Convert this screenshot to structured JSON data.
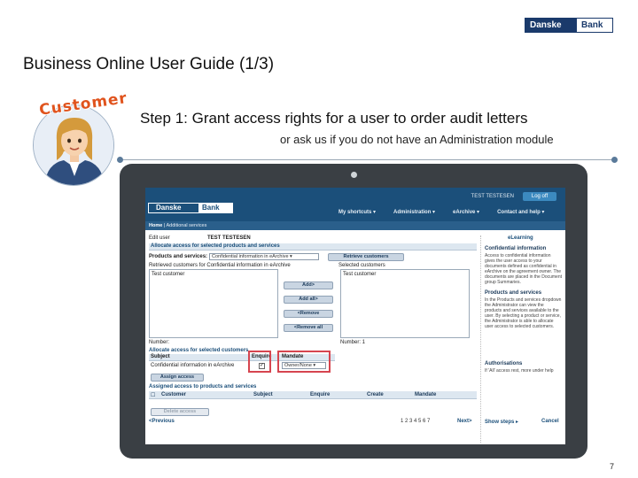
{
  "brand": {
    "left": "Danske",
    "right": "Bank"
  },
  "slide": {
    "title": "Business Online User Guide (1/3)",
    "step_title": "Step 1: Grant access rights for a user to order audit letters",
    "step_sub": "or ask us if you do not have an Administration module",
    "badge": "Customer",
    "page_number": "7"
  },
  "app": {
    "user": "TEST TESTESEN",
    "logout": "Log off",
    "logo_left": "Danske",
    "logo_right": "Bank",
    "nav": [
      "My shortcuts ▾",
      "Administration ▾",
      "eArchive ▾",
      "Contact and help ▾"
    ],
    "crumb_home": "Home",
    "crumb_page": "Additional services",
    "edit_label": "Edit user",
    "edit_user": "TEST TESTESEN",
    "elearning": "eLearning",
    "allocate_title": "Allocate access for selected products and services",
    "products_label": "Products and services:",
    "products_value": "Confidential information in eArchive",
    "retrieve_btn": "Retrieve customers",
    "retrieved_label": "Retrieved customers for Confidential information in eArchive",
    "selected_label": "Selected customers",
    "retrieved_item": "Test customer",
    "selected_item": "Test customer",
    "add_btn": "Add>",
    "add_all_btn": "Add all>",
    "remove_btn": "<Remove",
    "remove_all_btn": "<Remove all",
    "number_label_left": "Number:",
    "number_label_right": "Number: 1",
    "allocate_sel_title": "Allocate access for selected customers",
    "subject_col": "Subject",
    "enquire_col": "Enquire",
    "mandate_col": "Mandate",
    "subject_value": "Confidential information in eArchive",
    "enquire_checked": "✓",
    "mandate_value": "Owner/None",
    "assign_btn": "Assign access",
    "assigned_title": "Assigned access to products and services",
    "table_cols": [
      "Customer",
      "Subject",
      "Enquire",
      "Create",
      "Mandate"
    ],
    "delete_btn": "Delete access",
    "prev": "<Previous",
    "pages": "1  2  3  4  5  6  7",
    "next": "Next>",
    "show_steps": "Show steps ▸",
    "cancel": "Cancel",
    "side": {
      "conf_title": "Confidential information",
      "conf_text": "Access to confidential information gives the user access to your documents defined as confidential in eArchive on the agreement owner. The documents are placed in the Document group Summaries.",
      "prod_title": "Products and services",
      "prod_text": "In the Products and services dropdown the Administrator can view the products and services available to the user. By selecting a product or service, the Administrator is able to allocate user access to selected customers.",
      "auth_title": "Authorisations",
      "auth_text": "If 'All' access rest, more under help"
    }
  },
  "colors": {
    "brand_navy": "#1a3a6b",
    "app_blue": "#1b4f7a",
    "highlight_red": "#d6454f",
    "badge_orange": "#e0531d"
  }
}
